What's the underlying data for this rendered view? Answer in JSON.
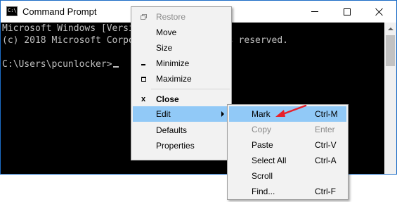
{
  "window": {
    "title": "Command Prompt",
    "app_icon": "C:\\_"
  },
  "console": {
    "lines": [
      "Microsoft Windows [Version 10.0.17134.228]",
      "(c) 2018 Microsoft Corporation. All rights reserved.",
      "",
      "C:\\Users\\pcunlocker>"
    ]
  },
  "system_menu": {
    "items": [
      {
        "label": "Restore",
        "icon": "restore-icon",
        "disabled": true
      },
      {
        "label": "Move"
      },
      {
        "label": "Size"
      },
      {
        "label": "Minimize",
        "icon": "minimize-icon"
      },
      {
        "label": "Maximize",
        "icon": "maximize-icon"
      },
      {
        "label": "Close",
        "icon": "close-icon",
        "bold": true
      },
      {
        "label": "Edit",
        "highlighted": true,
        "has_submenu": true
      },
      {
        "label": "Defaults"
      },
      {
        "label": "Properties"
      }
    ]
  },
  "edit_submenu": {
    "items": [
      {
        "label": "Mark",
        "shortcut": "Ctrl-M",
        "highlighted": true
      },
      {
        "label": "Copy",
        "shortcut": "Enter",
        "disabled": true
      },
      {
        "label": "Paste",
        "shortcut": "Ctrl-V"
      },
      {
        "label": "Select All",
        "shortcut": "Ctrl-A"
      },
      {
        "label": "Scroll",
        "shortcut": ""
      },
      {
        "label": "Find...",
        "shortcut": "Ctrl-F"
      }
    ]
  },
  "colors": {
    "highlight": "#91c9f7",
    "annotation_arrow": "#e8202a",
    "window_border": "#1c6cc6"
  }
}
